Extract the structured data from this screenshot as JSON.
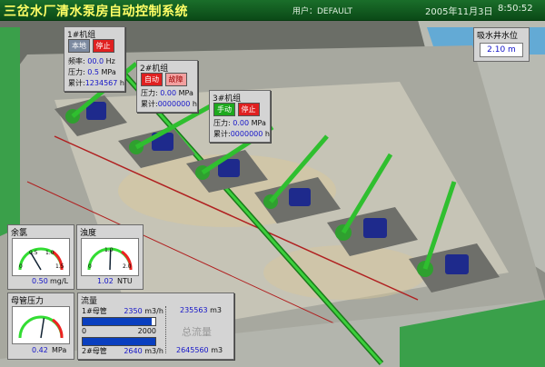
{
  "header": {
    "title": "三岔水厂清水泵房自动控制系统",
    "user": "用户：DEFAULT",
    "date": "2005年11月3日",
    "time": "8:50:52"
  },
  "colors": {
    "running": "#1ea81e",
    "stop": "#e02020",
    "fault": "#f2a0a0",
    "value": "#1414c8",
    "pipe": "#2fbf2f",
    "motor": "#1e2a8c"
  },
  "pump1": {
    "title": "1#机组",
    "mode": "本地",
    "state": "停止",
    "freq_label": "频率:",
    "freq": "00.0",
    "freq_unit": "Hz",
    "press_label": "压力:",
    "press": "0.5",
    "press_unit": "MPa",
    "acc_label": "累计:",
    "acc": "1234567",
    "acc_unit": "h"
  },
  "pump2": {
    "title": "2#机组",
    "mode": "自动",
    "state": "故障",
    "press_label": "压力:",
    "press": "0.00",
    "press_unit": "MPa",
    "acc_label": "累计:",
    "acc": "0000000",
    "acc_unit": "h"
  },
  "pump3": {
    "title": "3#机组",
    "mode": "手动",
    "state": "停止",
    "press_label": "压力:",
    "press": "0.00",
    "press_unit": "MPa",
    "acc_label": "累计:",
    "acc": "0000000",
    "acc_unit": "h"
  },
  "well": {
    "title": "吸水井水位",
    "value": "2.10 m"
  },
  "chlorine": {
    "title": "余氯",
    "value": "0.50",
    "unit": "mg/L",
    "scale": [
      "0",
      "0.5",
      "1.0",
      "1.5"
    ],
    "level": 0.33
  },
  "turbidity": {
    "title": "浊度",
    "value": "1.02",
    "unit": "NTU",
    "scale": [
      "0",
      "1.0",
      "2.0"
    ],
    "level": 0.51
  },
  "main_pressure": {
    "title": "母管压力",
    "value": "0.42",
    "unit": "MPa",
    "level": 0.55
  },
  "flow": {
    "title": "流量",
    "pipe1_label": "1#母管",
    "pipe1_rate": "2350",
    "pipe1_unit": "m3/h",
    "pipe1_total": "235563",
    "pipe1_total_unit": "m3",
    "scale_min": "0",
    "scale_max": "2000",
    "pipe2_label": "2#母管",
    "pipe2_rate": "2640",
    "pipe2_unit": "m3/h",
    "pipe2_total": "2645560",
    "pipe2_total_unit": "m3",
    "total_label": "总流量",
    "pipe1_level": 0.95,
    "pipe2_level": 1.0
  }
}
